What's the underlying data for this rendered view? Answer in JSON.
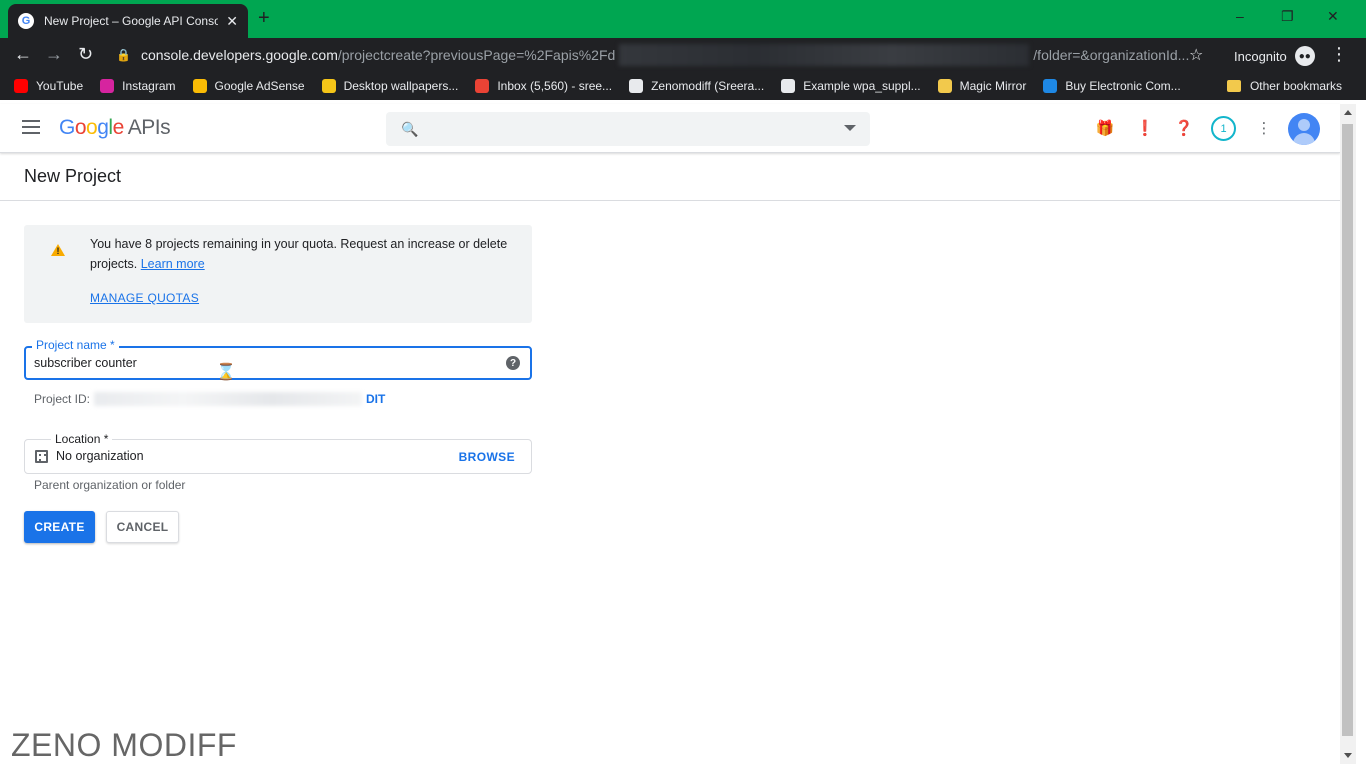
{
  "browser": {
    "tab_title": "New Project – Google API Conso",
    "tab_close": "✕",
    "new_tab": "+",
    "window_controls": [
      "–",
      "❐",
      "✕"
    ],
    "url_host": "console.developers.google.com",
    "url_path": "/projectcreate?previousPage=%2Fapis%2Fd",
    "url_tail": "/folder=&organizationId...",
    "incognito_label": "Incognito",
    "bookmarks": [
      {
        "label": "YouTube",
        "color": "#ff0000"
      },
      {
        "label": "Instagram",
        "color": "#d6249f"
      },
      {
        "label": "Google AdSense",
        "color": "#fbbc05"
      },
      {
        "label": "Desktop wallpapers...",
        "color": "#f5c518"
      },
      {
        "label": "Inbox (5,560) - sree...",
        "color": "#ea4335"
      },
      {
        "label": "Zenomodiff (Sreera...",
        "color": "#e8eaed"
      },
      {
        "label": "Example wpa_suppl...",
        "color": "#e8eaed"
      },
      {
        "label": "Magic Mirror",
        "color": "#f2c94c"
      },
      {
        "label": "Buy Electronic Com...",
        "color": "#1e88e5"
      }
    ],
    "other_bookmarks": "Other bookmarks"
  },
  "header": {
    "logo_google": [
      "G",
      "o",
      "o",
      "g",
      "l",
      "e"
    ],
    "logo_apis": "APIs",
    "notification_count": "1"
  },
  "page": {
    "title": "New Project"
  },
  "quota_notice": {
    "text": "You have 8 projects remaining in your quota. Request an increase or delete projects.",
    "learn_more": "Learn more",
    "manage_quotas": "MANAGE QUOTAS"
  },
  "form": {
    "project_name_label": "Project name *",
    "project_name_value": "subscriber counter",
    "project_id_label": "Project ID:",
    "project_id_tail": "DIT",
    "location_label": "Location *",
    "location_value": "No organization",
    "browse": "BROWSE",
    "location_hint": "Parent organization or folder",
    "create": "CREATE",
    "cancel": "CANCEL"
  },
  "watermark": "ZENO MODIFF",
  "colors": {
    "title_bar": "#00a651",
    "chrome_dark": "#202124",
    "primary_blue": "#1a73e8",
    "warning": "#f9ab00",
    "notification_ring": "#12b5cb"
  }
}
